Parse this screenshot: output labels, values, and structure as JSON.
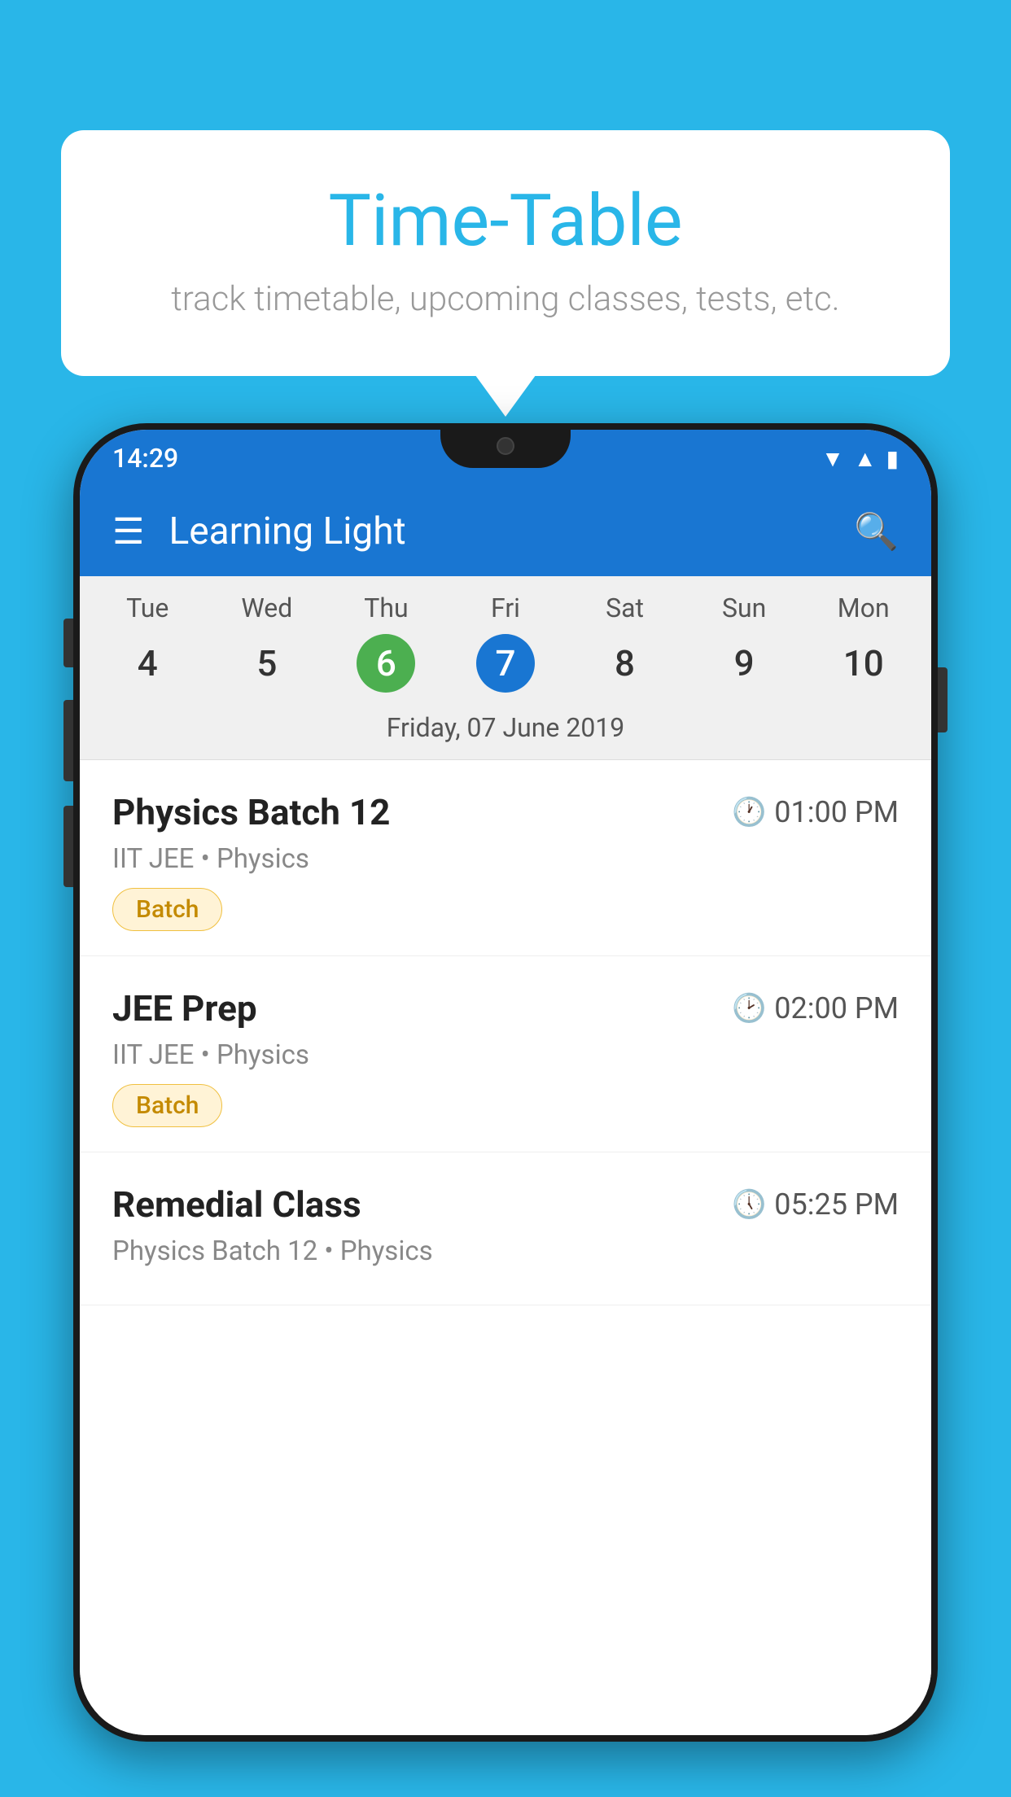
{
  "background_color": "#29b6e8",
  "speech_bubble": {
    "title": "Time-Table",
    "subtitle": "track timetable, upcoming classes, tests, etc."
  },
  "phone": {
    "status_bar": {
      "time": "14:29"
    },
    "app_bar": {
      "title": "Learning Light"
    },
    "calendar": {
      "days": [
        {
          "name": "Tue",
          "num": "4",
          "state": "normal"
        },
        {
          "name": "Wed",
          "num": "5",
          "state": "normal"
        },
        {
          "name": "Thu",
          "num": "6",
          "state": "today"
        },
        {
          "name": "Fri",
          "num": "7",
          "state": "selected"
        },
        {
          "name": "Sat",
          "num": "8",
          "state": "normal"
        },
        {
          "name": "Sun",
          "num": "9",
          "state": "normal"
        },
        {
          "name": "Mon",
          "num": "10",
          "state": "normal"
        }
      ],
      "selected_date_label": "Friday, 07 June 2019"
    },
    "schedule_items": [
      {
        "title": "Physics Batch 12",
        "time": "01:00 PM",
        "subtitle": "IIT JEE • Physics",
        "tag": "Batch"
      },
      {
        "title": "JEE Prep",
        "time": "02:00 PM",
        "subtitle": "IIT JEE • Physics",
        "tag": "Batch"
      },
      {
        "title": "Remedial Class",
        "time": "05:25 PM",
        "subtitle": "Physics Batch 12 • Physics",
        "tag": null
      }
    ]
  }
}
